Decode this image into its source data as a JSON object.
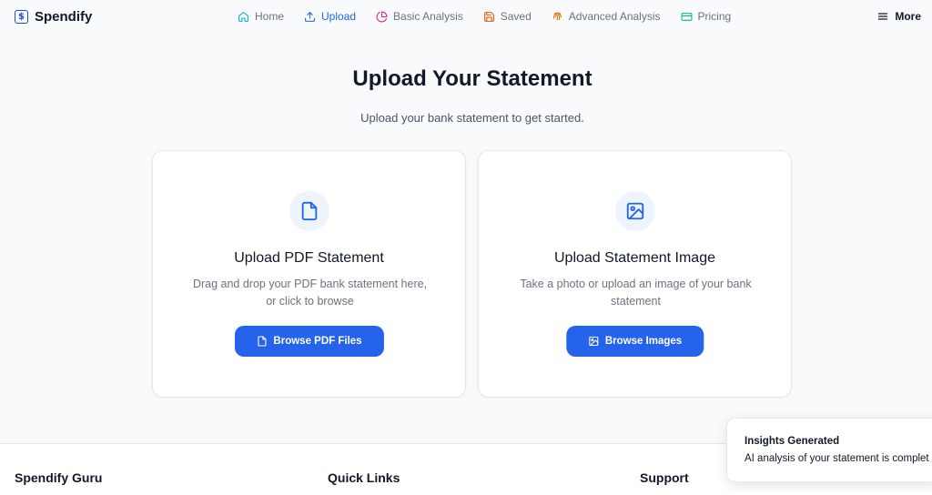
{
  "brand": {
    "name": "Spendify",
    "logo_icon": "dollar-square-icon"
  },
  "nav": {
    "items": [
      {
        "label": "Home",
        "icon": "home-icon",
        "active": false
      },
      {
        "label": "Upload",
        "icon": "upload-icon",
        "active": true
      },
      {
        "label": "Basic Analysis",
        "icon": "pie-chart-icon",
        "active": false
      },
      {
        "label": "Saved",
        "icon": "save-icon",
        "active": false
      },
      {
        "label": "Advanced Analysis",
        "icon": "fingerprint-icon",
        "active": false
      },
      {
        "label": "Pricing",
        "icon": "credit-card-icon",
        "active": false
      }
    ],
    "more_label": "More"
  },
  "page": {
    "title": "Upload Your Statement",
    "subtitle": "Upload your bank statement to get started."
  },
  "cards": {
    "pdf": {
      "title": "Upload PDF Statement",
      "description": "Drag and drop your PDF bank statement here, or click to browse",
      "button_label": "Browse PDF Files",
      "icon": "file-icon"
    },
    "image": {
      "title": "Upload Statement Image",
      "description": "Take a photo or upload an image of your bank statement",
      "button_label": "Browse Images",
      "icon": "image-icon"
    }
  },
  "footer": {
    "col1_heading": "Spendify Guru",
    "col2_heading": "Quick Links",
    "col3_heading": "Support"
  },
  "toast": {
    "title": "Insights Generated",
    "message": "AI analysis of your statement is complet"
  },
  "colors": {
    "accent": "#2563eb",
    "home_icon": "#0ea5e9",
    "basic_analysis_icon": "#db2777",
    "saved_icon": "#ea580c",
    "advanced_icon": "#d97706",
    "pricing_icon": "#10b981"
  }
}
